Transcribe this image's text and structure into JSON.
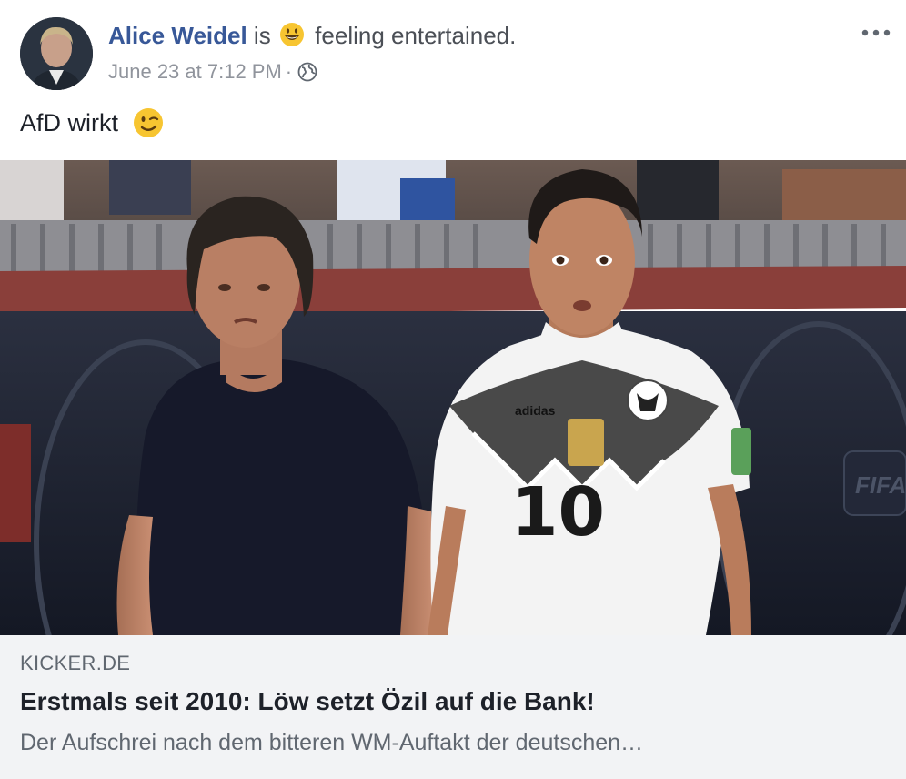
{
  "post": {
    "author": "Alice Weidel",
    "is_label": "is",
    "feeling_text": "feeling entertained.",
    "timestamp": "June 23 at 7:12 PM",
    "separator": "·",
    "privacy_icon": "globe-icon",
    "more_icon": "more-options-icon",
    "feeling_icon": "smiling-emoji-icon",
    "text": "AfD wirkt",
    "text_emoji_icon": "winking-emoji-icon"
  },
  "photo": {
    "jersey_number": "10",
    "brand_text": "adidas",
    "board_text": "FIFA"
  },
  "link_preview": {
    "domain": "KICKER.DE",
    "headline": "Erstmals seit 2010: Löw setzt Özil auf die Bank!",
    "description": "Der Aufschrei nach dem bitteren WM-Auftakt der deutschen…"
  },
  "colors": {
    "author": "#385898",
    "caption_bg": "#f2f3f5",
    "meta_text": "#90949c"
  }
}
